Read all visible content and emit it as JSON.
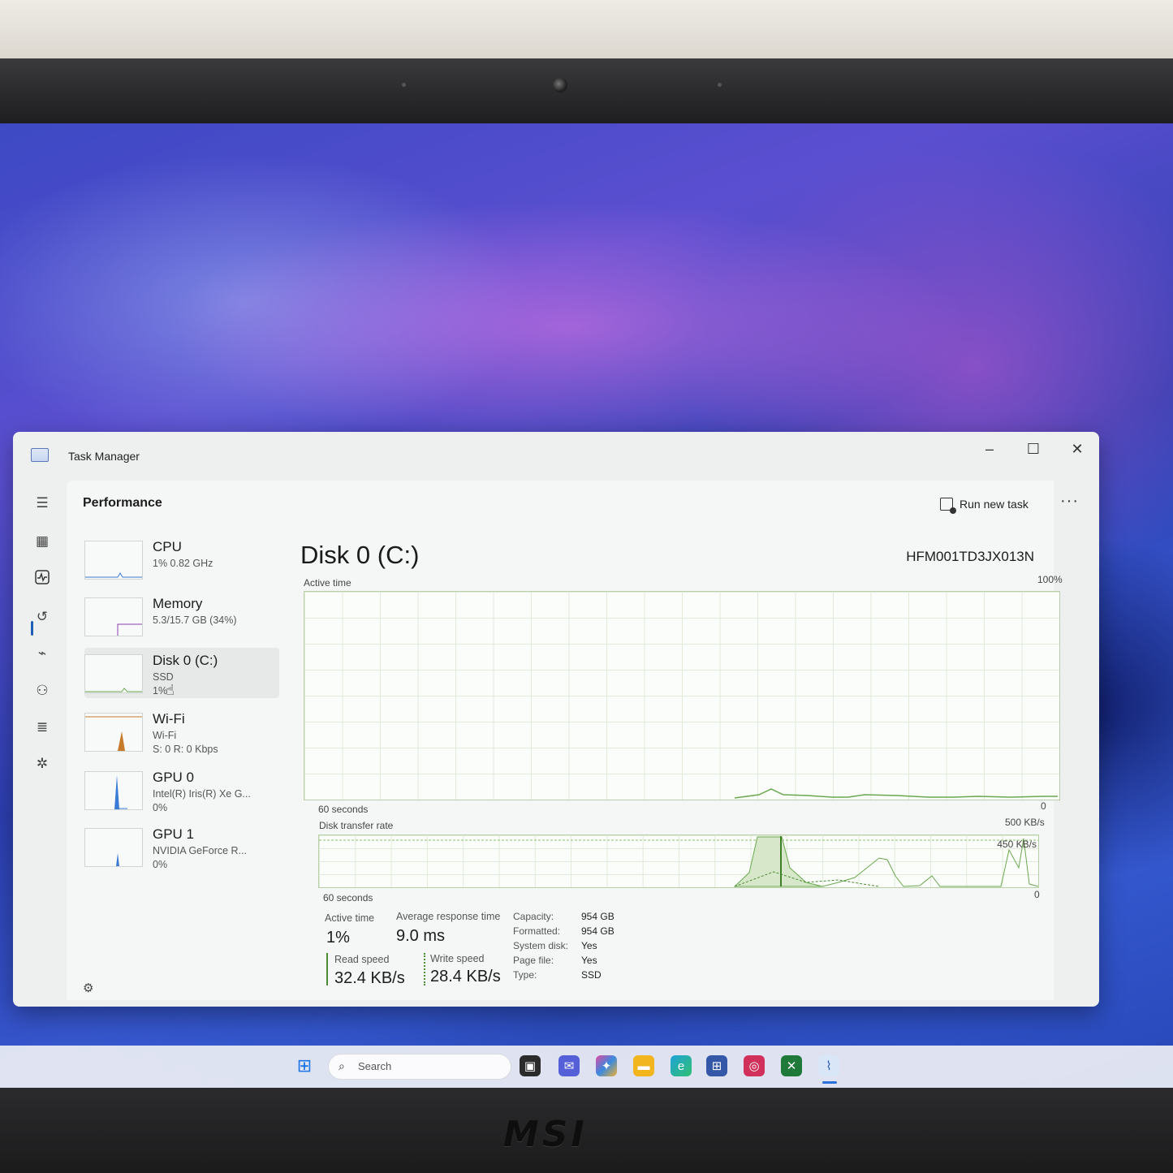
{
  "window": {
    "title": "Task Manager",
    "minimize": "–",
    "maximize": "☐",
    "close": "✕"
  },
  "header": {
    "page_title": "Performance",
    "run_new_task": "Run new task",
    "more": "···"
  },
  "nav_icons": [
    "hamburger-icon",
    "processes-icon",
    "performance-icon",
    "app-history-icon",
    "startup-apps-icon",
    "users-icon",
    "details-icon",
    "services-icon",
    "settings-icon"
  ],
  "devices": [
    {
      "name": "CPU",
      "sub1": "1% 0.82 GHz",
      "sub2": "",
      "sub3": ""
    },
    {
      "name": "Memory",
      "sub1": "5.3/15.7 GB (34%)",
      "sub2": "",
      "sub3": ""
    },
    {
      "name": "Disk 0 (C:)",
      "sub1": "SSD",
      "sub2": "1%",
      "sub3": ""
    },
    {
      "name": "Wi-Fi",
      "sub1": "Wi-Fi",
      "sub2": "S: 0 R: 0 Kbps",
      "sub3": ""
    },
    {
      "name": "GPU 0",
      "sub1": "Intel(R) Iris(R) Xe G...",
      "sub2": "0%",
      "sub3": ""
    },
    {
      "name": "GPU 1",
      "sub1": "NVIDIA GeForce R...",
      "sub2": "0%",
      "sub3": ""
    }
  ],
  "detail": {
    "title": "Disk 0 (C:)",
    "model": "HFM001TD3JX013N",
    "graph1": {
      "label": "Active time",
      "max": "100%",
      "time": "60 seconds",
      "min": "0"
    },
    "graph2": {
      "label": "Disk transfer rate",
      "max": "500 KB/s",
      "mark": "450 KB/s",
      "time": "60 seconds",
      "min": "0"
    },
    "stats": {
      "active_time_label": "Active time",
      "active_time": "1%",
      "avg_response_label": "Average response time",
      "avg_response": "9.0 ms",
      "read_label": "Read speed",
      "read": "32.4 KB/s",
      "write_label": "Write speed",
      "write": "28.4 KB/s"
    },
    "properties": [
      {
        "key": "Capacity:",
        "value": "954 GB"
      },
      {
        "key": "Formatted:",
        "value": "954 GB"
      },
      {
        "key": "System disk:",
        "value": "Yes"
      },
      {
        "key": "Page file:",
        "value": "Yes"
      },
      {
        "key": "Type:",
        "value": "SSD"
      }
    ]
  },
  "taskbar": {
    "search_placeholder": "Search"
  },
  "brand": {
    "laptop_logo": "MSI"
  },
  "colors": {
    "disk_graph": "#6aa84f",
    "read_bar": "#4d8a35",
    "accent": "#1f5fb8"
  }
}
